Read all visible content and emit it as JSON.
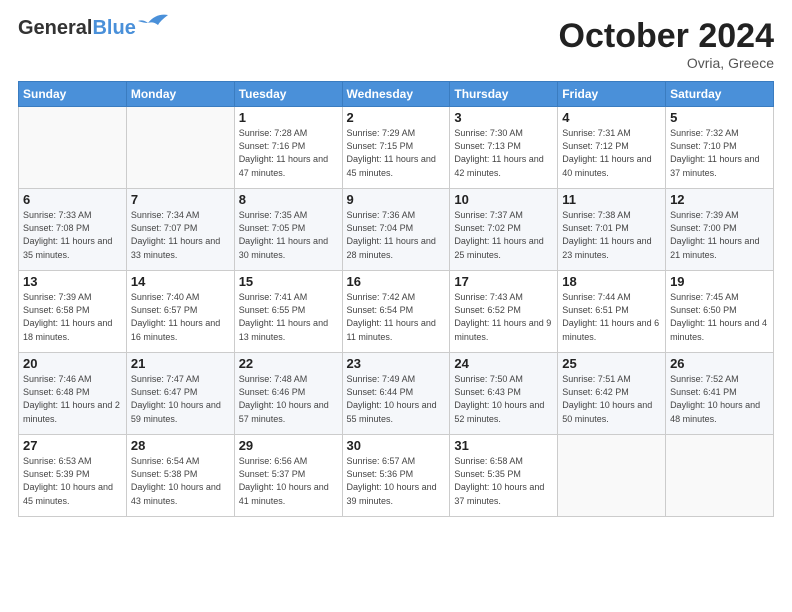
{
  "header": {
    "logo_line1": "General",
    "logo_line2": "Blue",
    "month": "October 2024",
    "location": "Ovria, Greece"
  },
  "weekdays": [
    "Sunday",
    "Monday",
    "Tuesday",
    "Wednesday",
    "Thursday",
    "Friday",
    "Saturday"
  ],
  "weeks": [
    [
      {
        "day": "",
        "info": ""
      },
      {
        "day": "",
        "info": ""
      },
      {
        "day": "1",
        "info": "Sunrise: 7:28 AM\nSunset: 7:16 PM\nDaylight: 11 hours and 47 minutes."
      },
      {
        "day": "2",
        "info": "Sunrise: 7:29 AM\nSunset: 7:15 PM\nDaylight: 11 hours and 45 minutes."
      },
      {
        "day": "3",
        "info": "Sunrise: 7:30 AM\nSunset: 7:13 PM\nDaylight: 11 hours and 42 minutes."
      },
      {
        "day": "4",
        "info": "Sunrise: 7:31 AM\nSunset: 7:12 PM\nDaylight: 11 hours and 40 minutes."
      },
      {
        "day": "5",
        "info": "Sunrise: 7:32 AM\nSunset: 7:10 PM\nDaylight: 11 hours and 37 minutes."
      }
    ],
    [
      {
        "day": "6",
        "info": "Sunrise: 7:33 AM\nSunset: 7:08 PM\nDaylight: 11 hours and 35 minutes."
      },
      {
        "day": "7",
        "info": "Sunrise: 7:34 AM\nSunset: 7:07 PM\nDaylight: 11 hours and 33 minutes."
      },
      {
        "day": "8",
        "info": "Sunrise: 7:35 AM\nSunset: 7:05 PM\nDaylight: 11 hours and 30 minutes."
      },
      {
        "day": "9",
        "info": "Sunrise: 7:36 AM\nSunset: 7:04 PM\nDaylight: 11 hours and 28 minutes."
      },
      {
        "day": "10",
        "info": "Sunrise: 7:37 AM\nSunset: 7:02 PM\nDaylight: 11 hours and 25 minutes."
      },
      {
        "day": "11",
        "info": "Sunrise: 7:38 AM\nSunset: 7:01 PM\nDaylight: 11 hours and 23 minutes."
      },
      {
        "day": "12",
        "info": "Sunrise: 7:39 AM\nSunset: 7:00 PM\nDaylight: 11 hours and 21 minutes."
      }
    ],
    [
      {
        "day": "13",
        "info": "Sunrise: 7:39 AM\nSunset: 6:58 PM\nDaylight: 11 hours and 18 minutes."
      },
      {
        "day": "14",
        "info": "Sunrise: 7:40 AM\nSunset: 6:57 PM\nDaylight: 11 hours and 16 minutes."
      },
      {
        "day": "15",
        "info": "Sunrise: 7:41 AM\nSunset: 6:55 PM\nDaylight: 11 hours and 13 minutes."
      },
      {
        "day": "16",
        "info": "Sunrise: 7:42 AM\nSunset: 6:54 PM\nDaylight: 11 hours and 11 minutes."
      },
      {
        "day": "17",
        "info": "Sunrise: 7:43 AM\nSunset: 6:52 PM\nDaylight: 11 hours and 9 minutes."
      },
      {
        "day": "18",
        "info": "Sunrise: 7:44 AM\nSunset: 6:51 PM\nDaylight: 11 hours and 6 minutes."
      },
      {
        "day": "19",
        "info": "Sunrise: 7:45 AM\nSunset: 6:50 PM\nDaylight: 11 hours and 4 minutes."
      }
    ],
    [
      {
        "day": "20",
        "info": "Sunrise: 7:46 AM\nSunset: 6:48 PM\nDaylight: 11 hours and 2 minutes."
      },
      {
        "day": "21",
        "info": "Sunrise: 7:47 AM\nSunset: 6:47 PM\nDaylight: 10 hours and 59 minutes."
      },
      {
        "day": "22",
        "info": "Sunrise: 7:48 AM\nSunset: 6:46 PM\nDaylight: 10 hours and 57 minutes."
      },
      {
        "day": "23",
        "info": "Sunrise: 7:49 AM\nSunset: 6:44 PM\nDaylight: 10 hours and 55 minutes."
      },
      {
        "day": "24",
        "info": "Sunrise: 7:50 AM\nSunset: 6:43 PM\nDaylight: 10 hours and 52 minutes."
      },
      {
        "day": "25",
        "info": "Sunrise: 7:51 AM\nSunset: 6:42 PM\nDaylight: 10 hours and 50 minutes."
      },
      {
        "day": "26",
        "info": "Sunrise: 7:52 AM\nSunset: 6:41 PM\nDaylight: 10 hours and 48 minutes."
      }
    ],
    [
      {
        "day": "27",
        "info": "Sunrise: 6:53 AM\nSunset: 5:39 PM\nDaylight: 10 hours and 45 minutes."
      },
      {
        "day": "28",
        "info": "Sunrise: 6:54 AM\nSunset: 5:38 PM\nDaylight: 10 hours and 43 minutes."
      },
      {
        "day": "29",
        "info": "Sunrise: 6:56 AM\nSunset: 5:37 PM\nDaylight: 10 hours and 41 minutes."
      },
      {
        "day": "30",
        "info": "Sunrise: 6:57 AM\nSunset: 5:36 PM\nDaylight: 10 hours and 39 minutes."
      },
      {
        "day": "31",
        "info": "Sunrise: 6:58 AM\nSunset: 5:35 PM\nDaylight: 10 hours and 37 minutes."
      },
      {
        "day": "",
        "info": ""
      },
      {
        "day": "",
        "info": ""
      }
    ]
  ]
}
